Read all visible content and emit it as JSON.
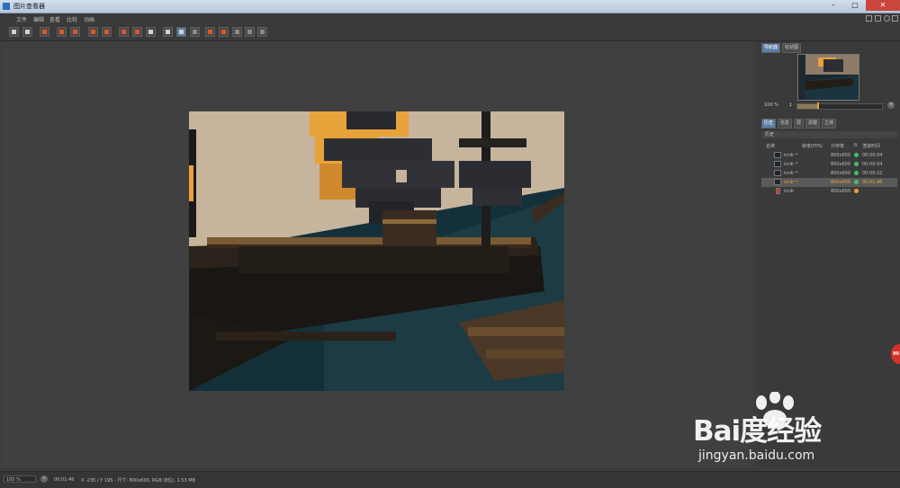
{
  "window": {
    "title": "图片查看器"
  },
  "menu": [
    "文件",
    "编辑",
    "查看",
    "比较",
    "动画"
  ],
  "right_panel": {
    "top_tabs": [
      "导航器",
      "柱状图"
    ],
    "zoom": "100 %",
    "zoom_stepper": "‡",
    "mid_tabs": [
      "历史",
      "信息",
      "层",
      "滤镜",
      "立体"
    ],
    "history_title": "历史",
    "columns": {
      "name": "名称",
      "fps": "帧率(FPS)",
      "resolution": "分辨率",
      "r": "R",
      "render_time": "渲染时间"
    },
    "rows": [
      {
        "name": "icrdr *",
        "resolution": "800x600",
        "time": "00:00:04",
        "status_color": "#3ec26a"
      },
      {
        "name": "icrdr *",
        "resolution": "800x600",
        "time": "00:00:04",
        "status_color": "#3ec26a"
      },
      {
        "name": "icrdr *",
        "resolution": "800x600",
        "time": "00:00:22",
        "status_color": "#3ec26a"
      },
      {
        "name": "icrdr *",
        "resolution": "800x600",
        "time": "00:01:46",
        "status_color": "#3ec26a",
        "highlight": "#e8a23a"
      },
      {
        "name": "icrdr",
        "resolution": "800x600",
        "time": "",
        "status_color": "#e8a23a"
      }
    ]
  },
  "status": {
    "zoom": "100 %",
    "time": "00:01:46",
    "info": "X -235 / Y 195 - 尺寸: 800x600, RGB (8位), 1.53 MB"
  },
  "badge": "90",
  "watermark": {
    "brand": "Bai度经验",
    "url": "jingyan.baidu.com"
  },
  "colors": {
    "accent": "#e8a23a",
    "sky": "#c7b49d",
    "water": "#16303a",
    "window_bg": "#3d3d3d"
  },
  "toolbar_icons": [
    "open-icon",
    "save-icon",
    "render-region-icon",
    "render-icon",
    "stop-icon",
    "clone-icon",
    "compare-ab-icon",
    "fit-icon",
    "channel-icon",
    "histogram-icon",
    "ab-a-icon",
    "ab-b-icon",
    "split-icon",
    "layout-icon",
    "layout2-icon"
  ]
}
